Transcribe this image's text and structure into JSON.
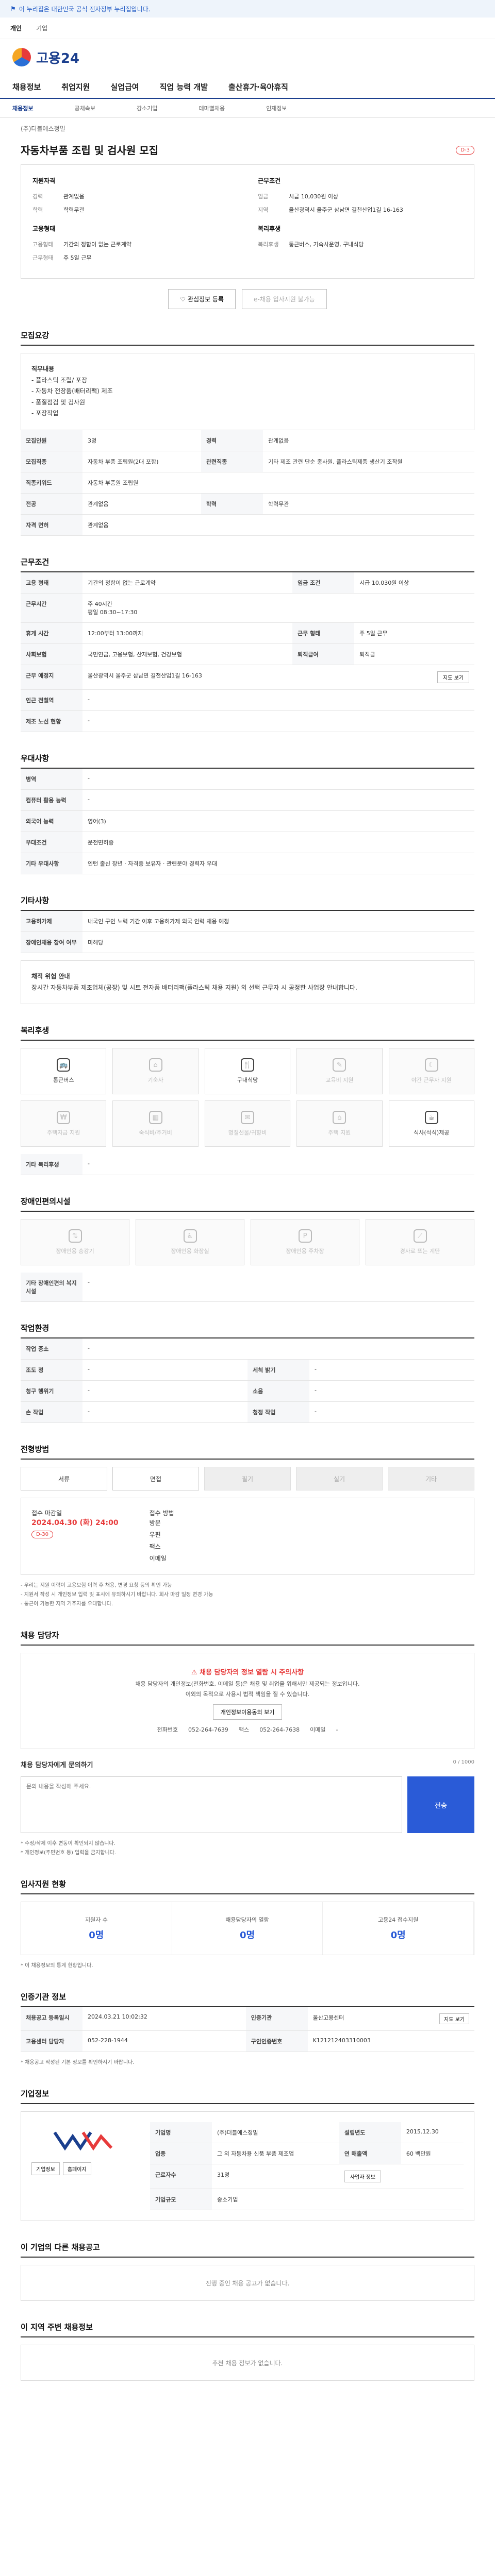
{
  "banner": {
    "text": "이 누리집은 대한민국 공식 전자정부 누리집입니다."
  },
  "topnav": {
    "items": [
      "개인",
      "기업"
    ]
  },
  "logo": {
    "text": "고용24"
  },
  "gnb": {
    "items": [
      "채용정보",
      "취업지원",
      "실업급여",
      "직업 능력 개발",
      "출산휴가·육아휴직"
    ]
  },
  "sub": {
    "items": [
      "채용정보",
      "공채속보",
      "강소기업",
      "테마별채용",
      "인재정보"
    ]
  },
  "job": {
    "title": "자동차부품 조립 및 검사원 모집",
    "corp": "(주)더블에스정밀",
    "badge": "D-3",
    "summary_left_title": "지원자격",
    "summary_right_title": "근무조건",
    "left": [
      {
        "k": "경력",
        "v": "관계없음"
      },
      {
        "k": "학력",
        "v": "학력무관"
      }
    ],
    "right": [
      {
        "k": "임금",
        "v": "시급 10,030원 이상"
      },
      {
        "k": "지역",
        "v": "울산광역시 울주군 삼남면 길천산업1길 16-163"
      }
    ],
    "left2_title": "고용형태",
    "left2": [
      {
        "k": "고용형태",
        "v": "기간의 정함이 없는 근로계약"
      },
      {
        "k": "근무형태",
        "v": "주 5일 근무"
      }
    ],
    "right2_title": "복리후생",
    "right2": [
      {
        "k": "복리후생",
        "v": "통근버스, 기숙사운영, 구내식당"
      }
    ]
  },
  "actions": {
    "apply": "관심정보 등록",
    "scrap": "e-채용 입사지원 불가능"
  },
  "sections": {
    "recruit": "모집요강",
    "condition": "근무조건",
    "welfare": "복리후생",
    "disabled": "장애인편의시설",
    "process": "전형방법",
    "contact": "채용 담당자",
    "stats": "입사지원 현황",
    "period": "인증기관 정보",
    "company": "기업정보",
    "other": "이 기업의 다른 채용공고",
    "around": "이 지역 주변 채용정보"
  },
  "recruit": {
    "duty_title": "직무내용",
    "duty": "- 플라스틱 조립/ 포장\n- 자동차 전장품(배터리팩) 제조\n- 품질점검 및 검사원\n- 포장작업",
    "rows": [
      {
        "k": "모집인원",
        "v": "3명",
        "k2": "경력",
        "v2": "관계없음"
      },
      {
        "k": "모집직종",
        "v": "자동차 부품 조립원(2대 포함)",
        "k2": "관련직종",
        "v2": "기타 제조 관련 단순 종사원, 플라스틱제품 생산기 조작원"
      },
      {
        "k": "직종키워드",
        "v": "자동차 부품원 조립원"
      },
      {
        "k": "전공",
        "v": "관계없음",
        "k2": "학력",
        "v2": "학력무관"
      },
      {
        "k": "자격 면허",
        "v": "관계없음"
      }
    ]
  },
  "condition": {
    "rows": [
      {
        "k": "고용 형태",
        "v": "기간의 정함이 없는 근로계약",
        "k2": "임금 조건",
        "v2": "시급 10,030원 이상"
      },
      {
        "k": "근무시간",
        "v": "주 40시간\n평일 08:30~17:30"
      },
      {
        "k": "휴게 시간",
        "v": "12:00부터 13:00까지",
        "k2": "근무 형태",
        "v2": "주 5일 근무"
      },
      {
        "k": "사회보험",
        "v": "국민연금, 고용보험, 산재보험, 건강보험",
        "k2": "퇴직급여",
        "v2": "퇴직금"
      },
      {
        "k": "근무 예정지",
        "v": "울산광역시 울주군 삼남면 길천산업1길 16-163"
      },
      {
        "k": "인근 전철역",
        "v": "-"
      },
      {
        "k": "제조 노선 현황",
        "v": "-"
      }
    ],
    "map_btn": "지도 보기"
  },
  "extra": {
    "title": "우대사항",
    "rows": [
      {
        "k": "병역",
        "v": "-"
      },
      {
        "k": "컴퓨터 활용 능력",
        "v": "-"
      },
      {
        "k": "외국어 능력",
        "v": "영어(3)"
      },
      {
        "k": "우대조건",
        "v": "운전면허증"
      },
      {
        "k": "기타 우대사항",
        "v": "인턴 출신 장년 · 자격증 보유자 · 관련분야 경력자 우대"
      }
    ]
  },
  "other_info": {
    "title": "기타사항",
    "rows": [
      {
        "k": "고용허가제",
        "v": "내국인 구인 노력 기간 이후 고용허가제 외국 인력 채용 예정"
      },
      {
        "k": "장애인채용 참여 여부",
        "v": "미해당"
      }
    ],
    "notice_title": "채적 위험 안내",
    "notice": "장시간 자동차부품 제조업체(공장) 및 시트 전자품 배터리팩(플라스틱 채용 지원) 외 선택 근무자 시 공정한 사업장 안내합니다."
  },
  "benefits": [
    {
      "icon": "bus-icon",
      "label": "통근버스",
      "on": true
    },
    {
      "icon": "home-icon",
      "label": "기숙사",
      "on": false
    },
    {
      "icon": "meal-icon",
      "label": "구내식당",
      "on": true
    },
    {
      "icon": "car-icon",
      "label": "교육비 지원",
      "on": false
    },
    {
      "icon": "baby-icon",
      "label": "야간 근무자 지원",
      "on": false
    },
    {
      "icon": "cert-icon",
      "label": "주택자금 지원",
      "on": false
    },
    {
      "icon": "dorm-icon",
      "label": "숙식비/주거비",
      "on": false
    },
    {
      "icon": "gift-icon",
      "label": "명절선물/귀향비",
      "on": false
    },
    {
      "icon": "med-icon",
      "label": "주택 지원",
      "on": false
    },
    {
      "icon": "flex-icon",
      "label": "식사(석식)제공",
      "on": true
    }
  ],
  "benefit_other": {
    "k": "기타 복리후생",
    "v": "-"
  },
  "disabled": [
    {
      "icon": "ramp-icon",
      "label": "장애인용 승강기"
    },
    {
      "icon": "toilet-icon",
      "label": "장애인용 화장실"
    },
    {
      "icon": "park-icon",
      "label": "장애인용 주차장"
    },
    {
      "icon": "ramp2-icon",
      "label": "경사로 또는 계단"
    }
  ],
  "disabled_other": {
    "k": "기타 장애인편의 복지시설",
    "v": "-"
  },
  "work_env": {
    "title": "작업환경",
    "rows": [
      {
        "k": "작업 중소",
        "v": "-"
      },
      {
        "k": "조도 정",
        "v": "-",
        "k2": "세척 밝기",
        "v2": "-"
      },
      {
        "k": "청구 행위기",
        "v": "-",
        "k2": "소음",
        "v2": "-"
      },
      {
        "k": "손 작업",
        "v": "-",
        "k2": "청정 작업",
        "v2": "-"
      }
    ]
  },
  "process": {
    "steps": [
      {
        "label": "서류",
        "on": true
      },
      {
        "label": "면접",
        "on": true
      },
      {
        "label": "필기",
        "on": false
      },
      {
        "label": "실기",
        "on": false
      },
      {
        "label": "기타",
        "on": false
      }
    ],
    "deadline_title": "접수 마감일",
    "deadline": "2024.04.30 (화) 24:00",
    "deadline_badge": "D-30",
    "method_title": "접수 방법",
    "methods": "방문\n우편\n팩스\n이메일",
    "notes": "- 우리는 지원 이력이 고용보험 이력 후 채용, 변경 요청 등의 확인 가능\n- 지원서 작성 시 개인정보 입력 및 표시에 유의하시기 바랍니다. 회사 마감 일정 변경 가능\n- 통근이 가능한 지역 거주자를 우대합니다."
  },
  "contact": {
    "alert_title": "채용 담당자의 정보 열람 시 주의사항",
    "alert_body": "채용 담당자의 개인정보(전화번호, 이메일 등)은 채용 및 취업을 위해서만 제공되는 정보입니다.\n이외의 목적으로 사용시 법적 책임을 질 수 있습니다.",
    "alert_btn": "개인정보이용동의 보기",
    "phone_label": "전화번호",
    "phone": "052-264-7639",
    "fax_label": "팩스",
    "fax": "052-264-7638",
    "email_label": "이메일",
    "email": "-",
    "inq_title": "채용 담당자에게 문의하기",
    "inq_placeholder": "문의 내용을 작성해 주세요.",
    "inq_send": "전송",
    "inq_count": "0 / 1000",
    "inq_notes": "* 수정/삭제 이후 변동이 확인되지 않습니다.\n* 개인정보(주민번호 등) 입력을 금지합니다."
  },
  "stats": [
    {
      "label": "지원자 수",
      "value": "0명"
    },
    {
      "label": "채용담당자의 열람",
      "value": "0명"
    },
    {
      "label": "고용24 접수지원",
      "value": "0명"
    }
  ],
  "stats_note": "* 이 채용정보의 통계 현황입니다.",
  "period": {
    "rows": [
      {
        "k": "채용공고 등록일시",
        "v": "2024.03.21 10:02:32",
        "k2": "인증기관",
        "v2": "울산고용센터"
      },
      {
        "k": "고용센터 담당자",
        "v": "052-228-1944",
        "k2": "구인인증번호",
        "v2": "K121212403310003"
      }
    ],
    "btn": "지도 보기",
    "note": "* 채용공고 작성된 기본 정보를 확인하시기 바랍니다."
  },
  "company": {
    "name": "(주)더블에스정밀",
    "rows": [
      {
        "k": "기업명",
        "v": "(주)더블에스정밀",
        "k2": "설립년도",
        "v2": "2015.12.30"
      },
      {
        "k": "업종",
        "v": "그 외 자동차용 신품 부품 제조업",
        "k2": "연 매출액",
        "v2": "60 백만원"
      },
      {
        "k": "근로자수",
        "v": "31명",
        "k2": "",
        "v2": ""
      },
      {
        "k": "기업규모",
        "v": "중소기업",
        "k2": "",
        "v2": ""
      }
    ],
    "btn1": "기업정보",
    "btn2": "홈페이지",
    "btn3": "사업자 정보"
  },
  "other_jobs": {
    "empty": "진행 중인 채용 공고가 없습니다."
  },
  "around": {
    "empty": "추천 채용 정보가 없습니다."
  }
}
